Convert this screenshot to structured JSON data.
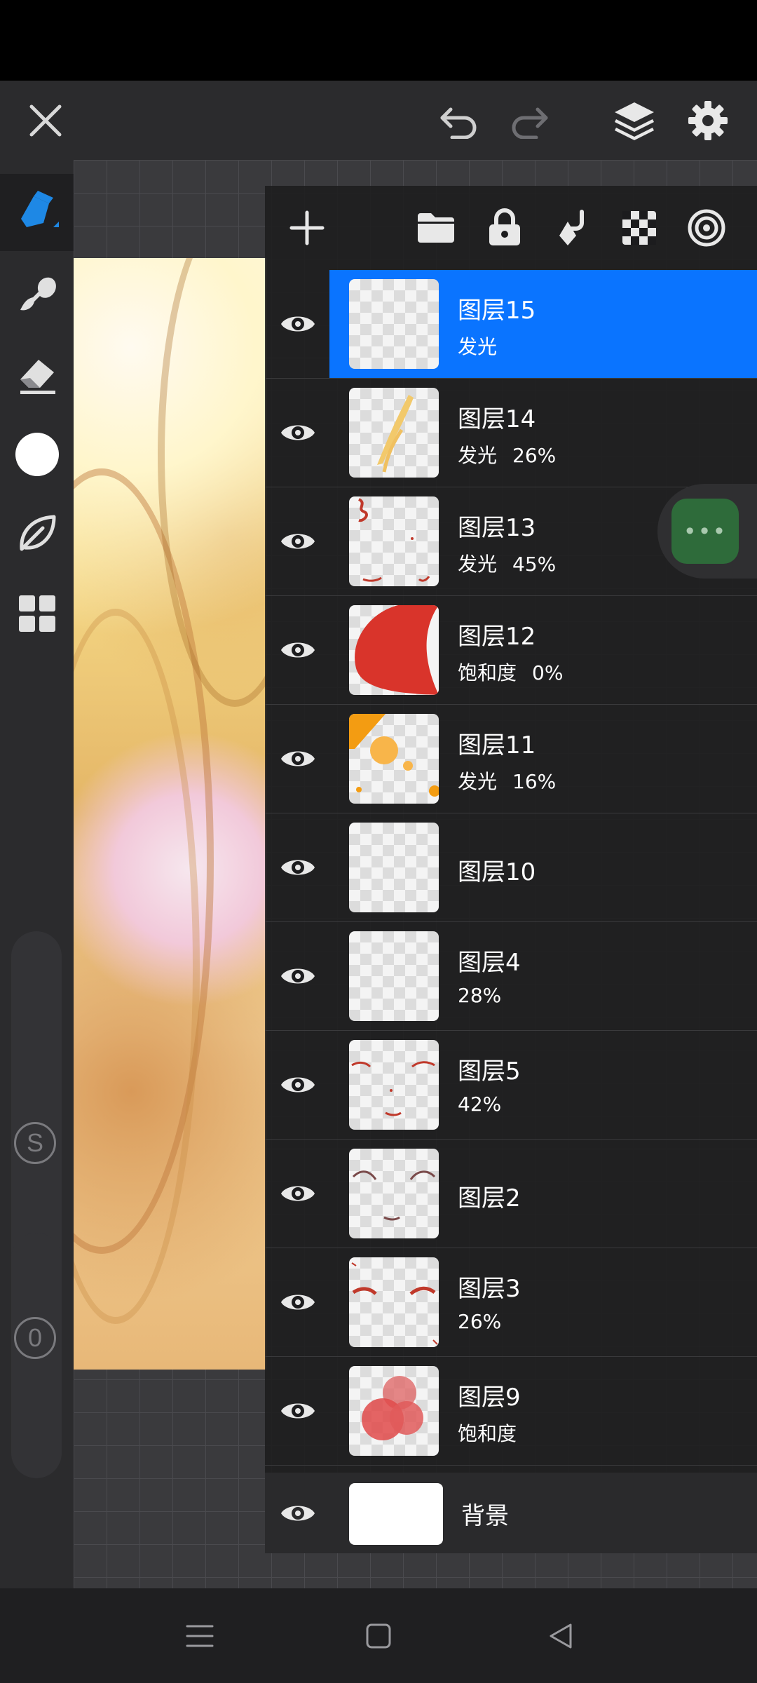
{
  "app": {
    "accent_color": "#0a74ff",
    "topbar_icons": [
      "close-icon",
      "undo-icon",
      "redo-icon",
      "layers-icon",
      "gear-icon"
    ]
  },
  "tools": [
    {
      "name": "pen-tool",
      "icon": "pen-icon",
      "active": true
    },
    {
      "name": "smudge-tool",
      "icon": "smudge-icon"
    },
    {
      "name": "eraser-tool",
      "icon": "eraser-icon"
    },
    {
      "name": "color-picker",
      "icon": "color-circle",
      "color": "#ffffff"
    },
    {
      "name": "brush-library",
      "icon": "leaf-icon"
    },
    {
      "name": "menu-grid",
      "icon": "grid-icon"
    }
  ],
  "sliders": {
    "size_label": "S",
    "opacity_label": "0"
  },
  "layer_panel": {
    "toolbar_icons": [
      "add-layer-icon",
      "folder-icon",
      "lock-icon",
      "merge-down-icon",
      "transparency-icon",
      "blend-icon"
    ],
    "layers": [
      {
        "name": "图层15",
        "blend": "发光",
        "opacity": "",
        "selected": true
      },
      {
        "name": "图层14",
        "blend": "发光",
        "opacity": "26%"
      },
      {
        "name": "图层13",
        "blend": "发光",
        "opacity": "45%"
      },
      {
        "name": "图层12",
        "blend": "饱和度",
        "opacity": "0%"
      },
      {
        "name": "图层11",
        "blend": "发光",
        "opacity": "16%"
      },
      {
        "name": "图层10",
        "blend": "",
        "opacity": ""
      },
      {
        "name": "图层4",
        "blend": "",
        "opacity": "28%"
      },
      {
        "name": "图层5",
        "blend": "",
        "opacity": "42%"
      },
      {
        "name": "图层2",
        "blend": "",
        "opacity": ""
      },
      {
        "name": "图层3",
        "blend": "",
        "opacity": "26%"
      },
      {
        "name": "图层9",
        "blend": "饱和度",
        "opacity": ""
      }
    ],
    "background_layer": {
      "name": "背景"
    }
  },
  "floating_button": {
    "label": "•••"
  },
  "navbar_icons": [
    "menu-icon",
    "home-icon",
    "back-icon"
  ]
}
